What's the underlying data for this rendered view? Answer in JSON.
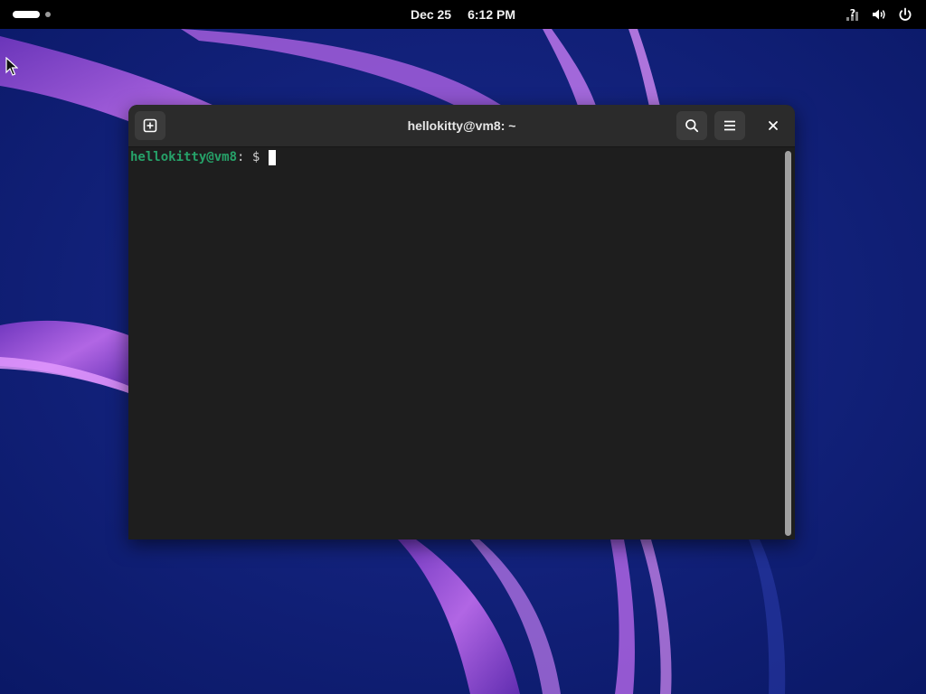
{
  "topbar": {
    "date": "Dec 25",
    "time": "6:12 PM",
    "tray_icons": [
      "network-unknown-icon",
      "volume-icon",
      "power-icon"
    ]
  },
  "terminal": {
    "title": "hellokitty@vm8: ~",
    "prompt_user_host": "hellokitty@vm8",
    "prompt_suffix": ": $ ",
    "header_icons": {
      "new_tab": "new-tab-icon",
      "search": "search-icon",
      "menu": "hamburger-menu-icon",
      "close": "close-icon"
    },
    "colors": {
      "background": "#1e1e1e",
      "headerbar": "#2b2b2b",
      "prompt_user": "#26a269",
      "cursor": "#ffffff"
    }
  },
  "desktop": {
    "wallpaper_colors": [
      "#0c1f78",
      "#a34fd6",
      "#d27cf2"
    ]
  }
}
